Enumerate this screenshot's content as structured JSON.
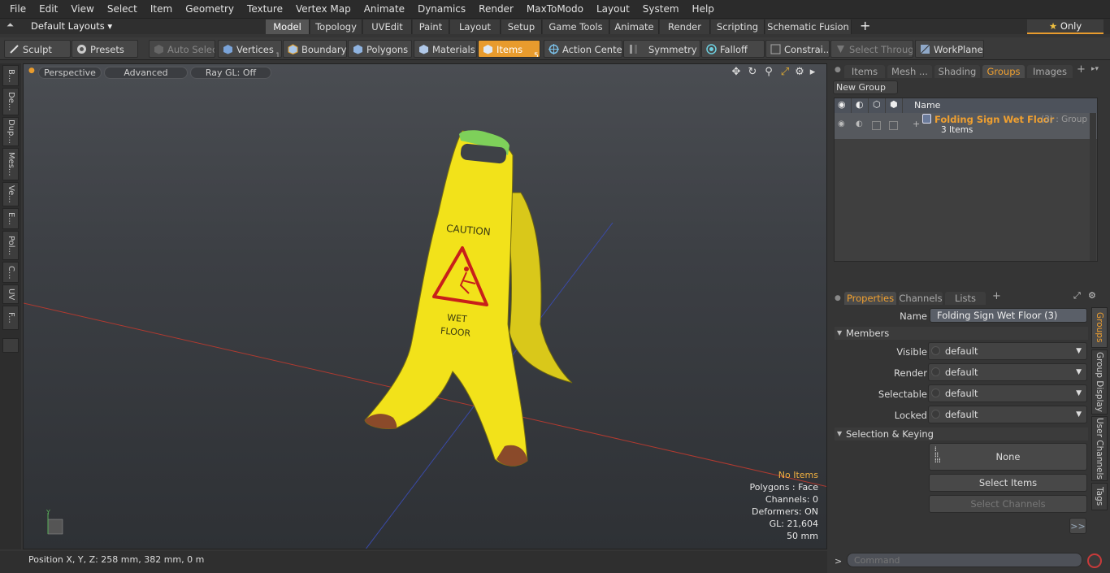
{
  "menu": [
    "File",
    "Edit",
    "View",
    "Select",
    "Item",
    "Geometry",
    "Texture",
    "Vertex Map",
    "Animate",
    "Dynamics",
    "Render",
    "MaxToModo",
    "Layout",
    "System",
    "Help"
  ],
  "layoutbar": {
    "layouts_label": "Default Layouts",
    "tabs": [
      "Model",
      "Topology",
      "UVEdit",
      "Paint",
      "Layout",
      "Setup",
      "Game Tools",
      "Animate",
      "Render",
      "Scripting",
      "Schematic Fusion"
    ],
    "add": "+",
    "only_label": "Only"
  },
  "toolbar": {
    "sculpt": "Sculpt",
    "presets": "Presets",
    "auto_select": "Auto Select",
    "vertices": "Vertices",
    "vertices_count": "1",
    "boundary": "Boundary",
    "polygons": "Polygons",
    "materials": "Materials",
    "items": "Items",
    "items_count": "5",
    "action_center": "Action Center",
    "symmetry": "Symmetry",
    "falloff": "Falloff",
    "constraints": "Constrai...",
    "select_through": "Select Through",
    "workplane": "WorkPlane"
  },
  "lefttabs": [
    "B...",
    "De...",
    "Dup...",
    "Mes...",
    "Ve...",
    "E...",
    "Pol...",
    "C...",
    "UV",
    "F..."
  ],
  "viewport": {
    "perspective": "Perspective",
    "advanced": "Advanced",
    "raygl": "Ray GL: Off",
    "sign_caution": "CAUTION",
    "sign_wet": "WET",
    "sign_floor": "FLOOR",
    "info": {
      "no_items": "No Items",
      "polygons": "Polygons : Face",
      "channels": "Channels: 0",
      "deformers": "Deformers: ON",
      "gl": "GL: 21,604",
      "scale": "50 mm"
    }
  },
  "status": {
    "position": "Position X, Y, Z:   258 mm, 382 mm, 0 m"
  },
  "right_top": {
    "tabs": [
      "Items",
      "Mesh ...",
      "Shading",
      "Groups",
      "Images"
    ],
    "new_group": "New Group",
    "name_col": "Name",
    "group": {
      "name": "Folding Sign Wet Floor",
      "suffix": "(3) : Group",
      "items": "3 Items"
    }
  },
  "properties": {
    "tabs": [
      "Properties",
      "Channels",
      "Lists"
    ],
    "name_label": "Name",
    "name_value": "Folding Sign Wet Floor (3)",
    "members": "Members",
    "visible_label": "Visible",
    "render_label": "Render",
    "selectable_label": "Selectable",
    "locked_label": "Locked",
    "default": "default",
    "selection_keying": "Selection & Keying",
    "none": "None",
    "select_items": "Select Items",
    "select_channels": "Select Channels",
    "more": ">>",
    "vtabs": [
      "Groups",
      "Group Display",
      "User Channels",
      "Tags"
    ]
  },
  "command": {
    "placeholder": "Command",
    "prompt": ">"
  },
  "colors": {
    "accent": "#e89b2d",
    "sign_yellow": "#f2e21a"
  }
}
